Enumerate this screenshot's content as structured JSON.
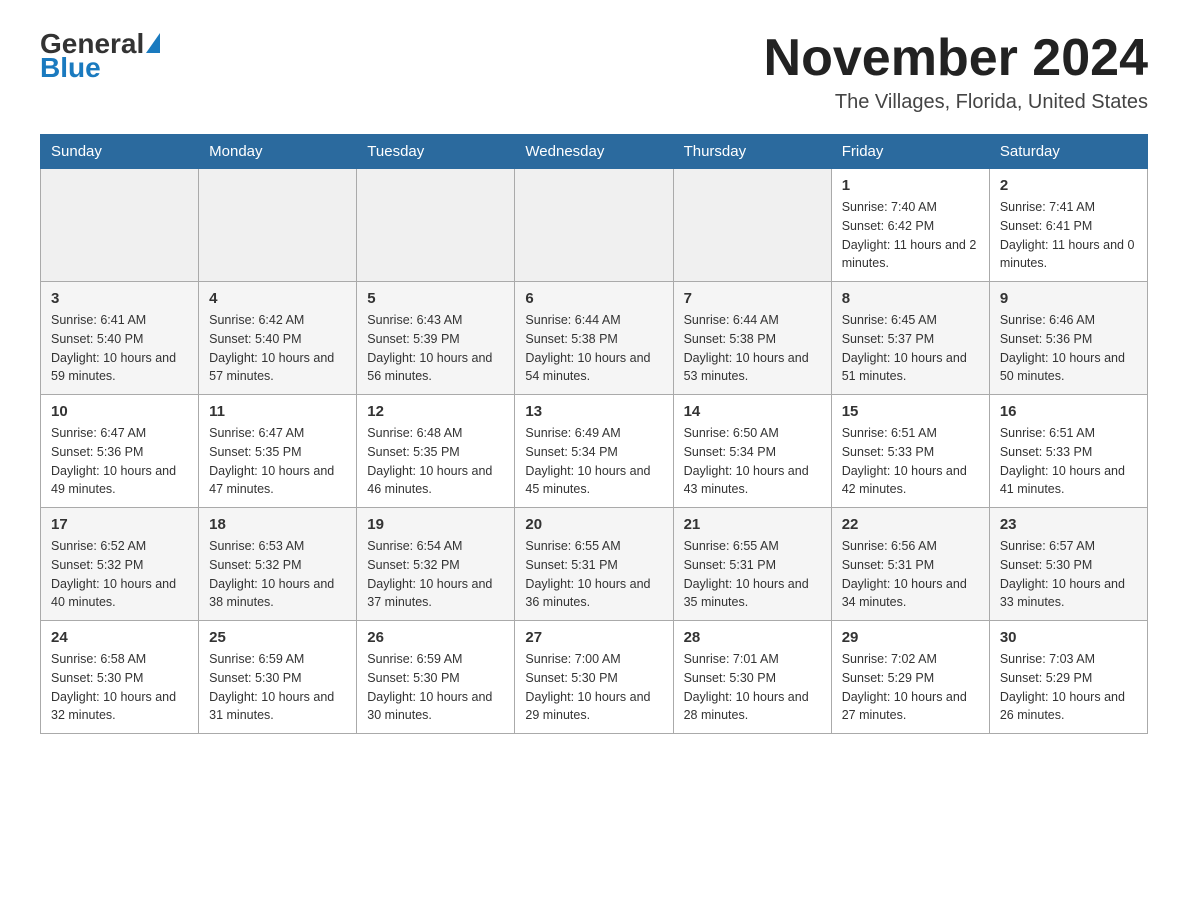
{
  "header": {
    "logo_line1": "General",
    "logo_line2": "Blue",
    "month_title": "November 2024",
    "location": "The Villages, Florida, United States"
  },
  "weekdays": [
    "Sunday",
    "Monday",
    "Tuesday",
    "Wednesday",
    "Thursday",
    "Friday",
    "Saturday"
  ],
  "rows": [
    {
      "days": [
        {
          "num": "",
          "info": ""
        },
        {
          "num": "",
          "info": ""
        },
        {
          "num": "",
          "info": ""
        },
        {
          "num": "",
          "info": ""
        },
        {
          "num": "",
          "info": ""
        },
        {
          "num": "1",
          "info": "Sunrise: 7:40 AM\nSunset: 6:42 PM\nDaylight: 11 hours and 2 minutes."
        },
        {
          "num": "2",
          "info": "Sunrise: 7:41 AM\nSunset: 6:41 PM\nDaylight: 11 hours and 0 minutes."
        }
      ]
    },
    {
      "days": [
        {
          "num": "3",
          "info": "Sunrise: 6:41 AM\nSunset: 5:40 PM\nDaylight: 10 hours and 59 minutes."
        },
        {
          "num": "4",
          "info": "Sunrise: 6:42 AM\nSunset: 5:40 PM\nDaylight: 10 hours and 57 minutes."
        },
        {
          "num": "5",
          "info": "Sunrise: 6:43 AM\nSunset: 5:39 PM\nDaylight: 10 hours and 56 minutes."
        },
        {
          "num": "6",
          "info": "Sunrise: 6:44 AM\nSunset: 5:38 PM\nDaylight: 10 hours and 54 minutes."
        },
        {
          "num": "7",
          "info": "Sunrise: 6:44 AM\nSunset: 5:38 PM\nDaylight: 10 hours and 53 minutes."
        },
        {
          "num": "8",
          "info": "Sunrise: 6:45 AM\nSunset: 5:37 PM\nDaylight: 10 hours and 51 minutes."
        },
        {
          "num": "9",
          "info": "Sunrise: 6:46 AM\nSunset: 5:36 PM\nDaylight: 10 hours and 50 minutes."
        }
      ]
    },
    {
      "days": [
        {
          "num": "10",
          "info": "Sunrise: 6:47 AM\nSunset: 5:36 PM\nDaylight: 10 hours and 49 minutes."
        },
        {
          "num": "11",
          "info": "Sunrise: 6:47 AM\nSunset: 5:35 PM\nDaylight: 10 hours and 47 minutes."
        },
        {
          "num": "12",
          "info": "Sunrise: 6:48 AM\nSunset: 5:35 PM\nDaylight: 10 hours and 46 minutes."
        },
        {
          "num": "13",
          "info": "Sunrise: 6:49 AM\nSunset: 5:34 PM\nDaylight: 10 hours and 45 minutes."
        },
        {
          "num": "14",
          "info": "Sunrise: 6:50 AM\nSunset: 5:34 PM\nDaylight: 10 hours and 43 minutes."
        },
        {
          "num": "15",
          "info": "Sunrise: 6:51 AM\nSunset: 5:33 PM\nDaylight: 10 hours and 42 minutes."
        },
        {
          "num": "16",
          "info": "Sunrise: 6:51 AM\nSunset: 5:33 PM\nDaylight: 10 hours and 41 minutes."
        }
      ]
    },
    {
      "days": [
        {
          "num": "17",
          "info": "Sunrise: 6:52 AM\nSunset: 5:32 PM\nDaylight: 10 hours and 40 minutes."
        },
        {
          "num": "18",
          "info": "Sunrise: 6:53 AM\nSunset: 5:32 PM\nDaylight: 10 hours and 38 minutes."
        },
        {
          "num": "19",
          "info": "Sunrise: 6:54 AM\nSunset: 5:32 PM\nDaylight: 10 hours and 37 minutes."
        },
        {
          "num": "20",
          "info": "Sunrise: 6:55 AM\nSunset: 5:31 PM\nDaylight: 10 hours and 36 minutes."
        },
        {
          "num": "21",
          "info": "Sunrise: 6:55 AM\nSunset: 5:31 PM\nDaylight: 10 hours and 35 minutes."
        },
        {
          "num": "22",
          "info": "Sunrise: 6:56 AM\nSunset: 5:31 PM\nDaylight: 10 hours and 34 minutes."
        },
        {
          "num": "23",
          "info": "Sunrise: 6:57 AM\nSunset: 5:30 PM\nDaylight: 10 hours and 33 minutes."
        }
      ]
    },
    {
      "days": [
        {
          "num": "24",
          "info": "Sunrise: 6:58 AM\nSunset: 5:30 PM\nDaylight: 10 hours and 32 minutes."
        },
        {
          "num": "25",
          "info": "Sunrise: 6:59 AM\nSunset: 5:30 PM\nDaylight: 10 hours and 31 minutes."
        },
        {
          "num": "26",
          "info": "Sunrise: 6:59 AM\nSunset: 5:30 PM\nDaylight: 10 hours and 30 minutes."
        },
        {
          "num": "27",
          "info": "Sunrise: 7:00 AM\nSunset: 5:30 PM\nDaylight: 10 hours and 29 minutes."
        },
        {
          "num": "28",
          "info": "Sunrise: 7:01 AM\nSunset: 5:30 PM\nDaylight: 10 hours and 28 minutes."
        },
        {
          "num": "29",
          "info": "Sunrise: 7:02 AM\nSunset: 5:29 PM\nDaylight: 10 hours and 27 minutes."
        },
        {
          "num": "30",
          "info": "Sunrise: 7:03 AM\nSunset: 5:29 PM\nDaylight: 10 hours and 26 minutes."
        }
      ]
    }
  ]
}
